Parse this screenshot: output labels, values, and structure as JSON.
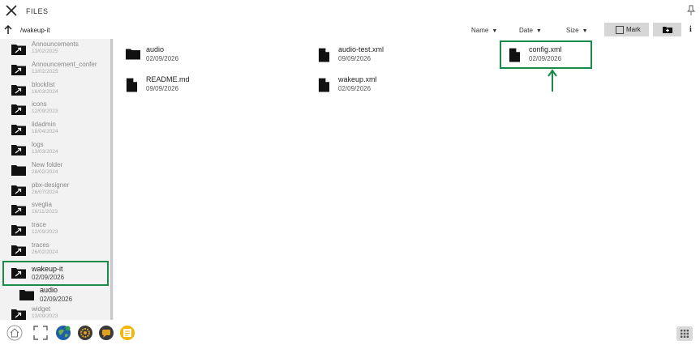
{
  "window": {
    "title": "FILES"
  },
  "nav": {
    "path": "/wakeup-it"
  },
  "sort": {
    "name": "Name",
    "date": "Date",
    "size": "Size"
  },
  "toolbar": {
    "mark_label": "Mark"
  },
  "sidebar": {
    "items": [
      {
        "name": "Announcements",
        "date": "13/02/2025",
        "icon": "folder-link-icon"
      },
      {
        "name": "Announcement_confer",
        "date": "13/02/2025",
        "icon": "folder-link-icon"
      },
      {
        "name": "blocklist",
        "date": "16/03/2024",
        "icon": "folder-link-icon"
      },
      {
        "name": "icons",
        "date": "12/09/2023",
        "icon": "folder-link-icon"
      },
      {
        "name": "lidadmin",
        "date": "18/04/2024",
        "icon": "folder-link-icon"
      },
      {
        "name": "logs",
        "date": "13/03/2024",
        "icon": "folder-link-icon"
      },
      {
        "name": "New folder",
        "date": "28/02/2024",
        "icon": "folder-icon"
      },
      {
        "name": "pbx-designer",
        "date": "26/07/2024",
        "icon": "folder-link-icon"
      },
      {
        "name": "sveglia",
        "date": "16/11/2023",
        "icon": "folder-link-icon"
      },
      {
        "name": "trace",
        "date": "12/09/2023",
        "icon": "folder-link-icon"
      },
      {
        "name": "traces",
        "date": "26/02/2024",
        "icon": "folder-link-icon"
      },
      {
        "name": "wakeup-it",
        "date": "02/09/2026",
        "icon": "folder-link-icon",
        "selected": true
      },
      {
        "name": "audio",
        "date": "02/09/2026",
        "icon": "folder-icon"
      },
      {
        "name": "widget",
        "date": "13/09/2023",
        "icon": "folder-link-icon"
      }
    ]
  },
  "files": [
    {
      "name": "audio",
      "date": "02/09/2026",
      "icon": "folder-icon"
    },
    {
      "name": "audio-test.xml",
      "date": "09/09/2026",
      "icon": "file-icon"
    },
    {
      "name": "config.xml",
      "date": "02/09/2026",
      "icon": "file-icon",
      "highlighted": true
    },
    {
      "name": "README.md",
      "date": "09/09/2026",
      "icon": "file-icon"
    },
    {
      "name": "wakeup.xml",
      "date": "02/09/2026",
      "icon": "file-icon"
    }
  ],
  "colors": {
    "highlight": "#1a8a4a",
    "toolbar_button": "#d6d6d6",
    "sidebar_bg": "#f2f2f2"
  }
}
